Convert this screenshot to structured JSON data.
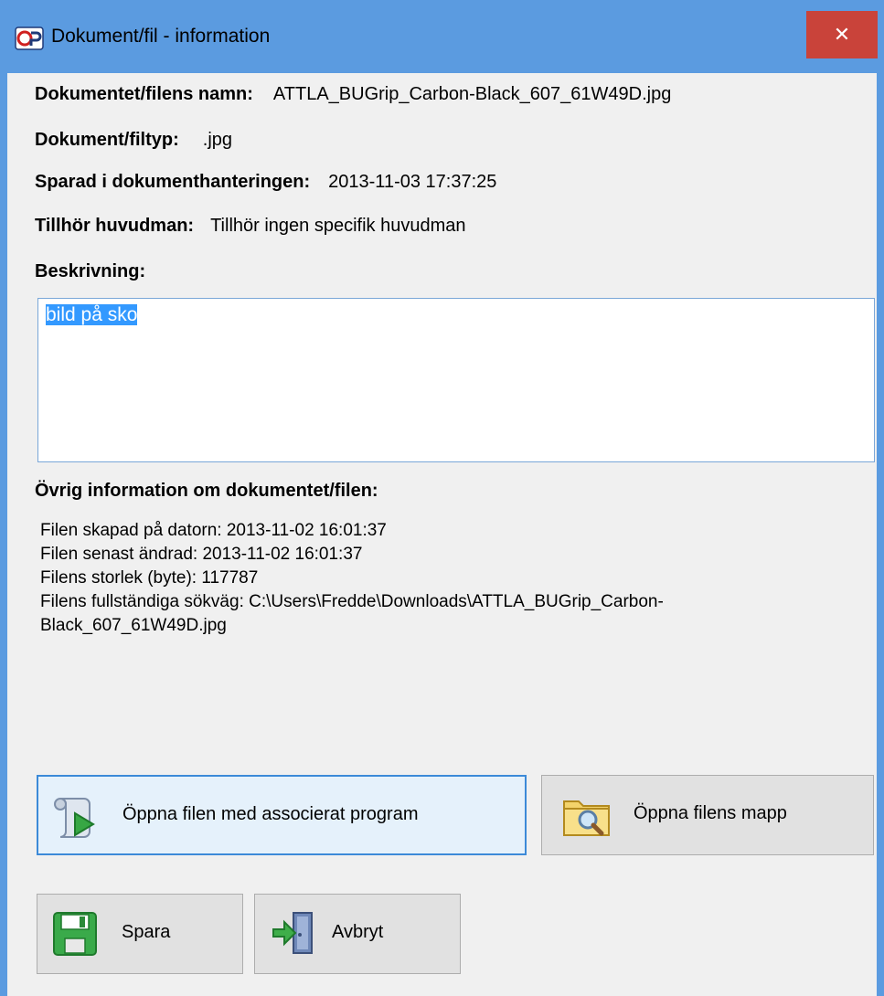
{
  "window": {
    "title": "Dokument/fil - information",
    "close_glyph": "✕",
    "accent": "#5b9be0",
    "close_color": "#c9433a"
  },
  "fields": {
    "name_label": "Dokumentet/filens namn:",
    "name_value": "ATTLA_BUGrip_Carbon-Black_607_61W49D.jpg",
    "type_label": "Dokument/filtyp:",
    "type_value": ".jpg",
    "saved_label": "Sparad i dokumenthanteringen:",
    "saved_value": "2013-11-03 17:37:25",
    "owner_label": "Tillhör huvudman:",
    "owner_value": "Tillhör ingen specifik huvudman",
    "description_label": "Beskrivning:",
    "description_value": "bild på sko"
  },
  "other_info": {
    "heading": "Övrig information om dokumentet/filen:",
    "created": "Filen skapad på datorn: 2013-11-02 16:01:37",
    "modified": "Filen senast ändrad: 2013-11-02 16:01:37",
    "size": "Filens storlek (byte): 117787",
    "path_line1": "Filens fullständiga sökväg: C:\\Users\\Fredde\\Downloads\\ATTLA_BUGrip_Carbon-",
    "path_line2": "Black_607_61W49D.jpg"
  },
  "buttons": {
    "open_with_program": "Öppna filen med associerat program",
    "open_folder": "Öppna filens mapp",
    "save": "Spara",
    "cancel": "Avbryt"
  },
  "icons": {
    "app": "app-logo-icon",
    "close": "close-icon",
    "open_program": "scroll-play-icon",
    "open_folder": "folder-magnifier-icon",
    "save": "floppy-disk-icon",
    "cancel": "exit-door-icon"
  }
}
